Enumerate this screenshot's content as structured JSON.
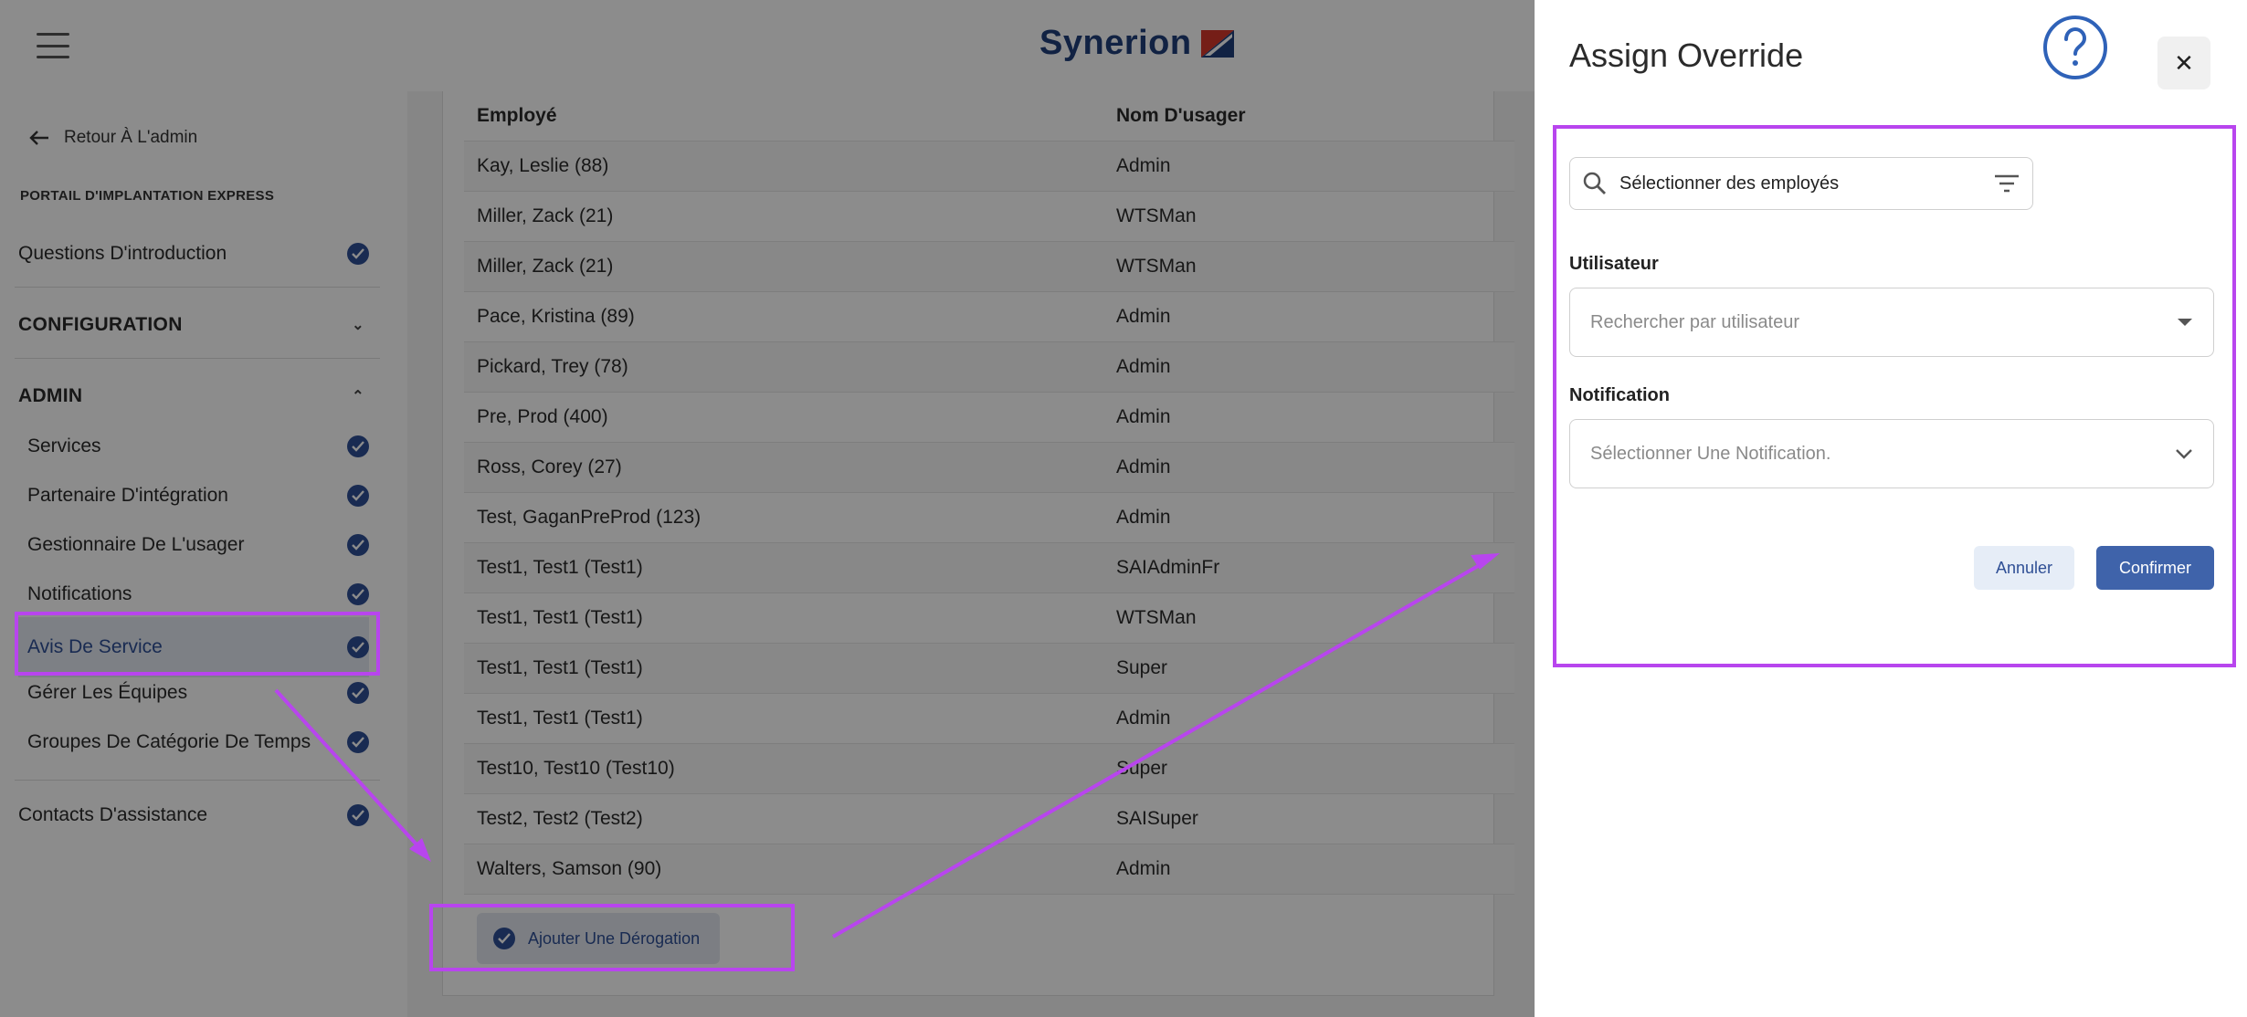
{
  "header": {
    "brand": "Synerion"
  },
  "sidebar": {
    "back_label": "Retour À L'admin",
    "portal_label": "PORTAIL D'IMPLANTATION EXPRESS",
    "intro": "Questions D'introduction",
    "configuration": "CONFIGURATION",
    "admin": "ADMIN",
    "admin_items": [
      "Services",
      "Partenaire D'intégration",
      "Gestionnaire De L'usager",
      "Notifications",
      "Avis De Service",
      "Gérer Les Équipes",
      "Groupes De Catégorie De Temps"
    ],
    "contacts": "Contacts D'assistance"
  },
  "table": {
    "headers": [
      "Employé",
      "Nom D'usager"
    ],
    "rows": [
      [
        "Kay, Leslie (88)",
        "Admin"
      ],
      [
        "Miller, Zack (21)",
        "WTSMan"
      ],
      [
        "Miller, Zack (21)",
        "WTSMan"
      ],
      [
        "Pace, Kristina (89)",
        "Admin"
      ],
      [
        "Pickard, Trey (78)",
        "Admin"
      ],
      [
        "Pre, Prod (400)",
        "Admin"
      ],
      [
        "Ross, Corey (27)",
        "Admin"
      ],
      [
        "Test, GaganPreProd (123)",
        "Admin"
      ],
      [
        "Test1, Test1 (Test1)",
        "SAIAdminFr"
      ],
      [
        "Test1, Test1 (Test1)",
        "WTSMan"
      ],
      [
        "Test1, Test1 (Test1)",
        "Super"
      ],
      [
        "Test1, Test1 (Test1)",
        "Admin"
      ],
      [
        "Test10, Test10 (Test10)",
        "Super"
      ],
      [
        "Test2, Test2 (Test2)",
        "SAISuper"
      ],
      [
        "Walters, Samson (90)",
        "Admin"
      ]
    ]
  },
  "add_button": "Ajouter Une Dérogation",
  "panel": {
    "title": "Assign Override",
    "search_placeholder": "Sélectionner des employés",
    "user_label": "Utilisateur",
    "user_placeholder": "Rechercher par utilisateur",
    "notification_label": "Notification",
    "notification_placeholder": "Sélectionner Une Notification.",
    "cancel": "Annuler",
    "confirm": "Confirmer"
  },
  "colors": {
    "accent": "#3f63aa",
    "annotation": "#b845ee",
    "check": "#2f4f95"
  }
}
